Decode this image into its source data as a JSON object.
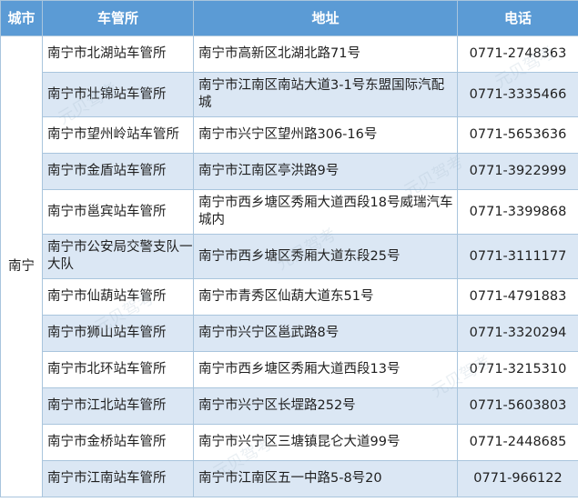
{
  "headers": [
    "城市",
    "车管所",
    "地址",
    "电话"
  ],
  "city": "南宁",
  "rows": [
    {
      "office": "南宁市北湖站车管所",
      "address": "南宁市高新区北湖北路71号",
      "phone": "0771-2748363"
    },
    {
      "office": "南宁市壮锦站车管所",
      "address": "南宁市江南区南站大道3-1号东盟国际汽配城",
      "phone": "0771-3335466"
    },
    {
      "office": "南宁市望州岭站车管所",
      "address": "南宁市兴宁区望州路306-16号",
      "phone": "0771-5653636"
    },
    {
      "office": "南宁市金盾站车管所",
      "address": "南宁市江南区亭洪路9号",
      "phone": "0771-3922999"
    },
    {
      "office": "南宁市邕宾站车管所",
      "address": "南宁市西乡塘区秀厢大道西段18号威瑞汽车城内",
      "phone": "0771-3399868"
    },
    {
      "office": "南宁市公安局交警支队一大队",
      "address": "南宁市西乡塘区秀厢大道东段25号",
      "phone": "0771-3111177"
    },
    {
      "office": "南宁市仙葫站车管所",
      "address": "南宁市青秀区仙葫大道东51号",
      "phone": "0771-4791883"
    },
    {
      "office": "南宁市狮山站车管所",
      "address": "南宁市兴宁区邕武路8号",
      "phone": "0771-3320294"
    },
    {
      "office": "南宁市北环站车管所",
      "address": "南宁市西乡塘区秀厢大道西段13号",
      "phone": "0771-3215310"
    },
    {
      "office": "南宁市江北站车管所",
      "address": "南宁市兴宁区长堽路252号",
      "phone": "0771-5603803"
    },
    {
      "office": "南宁市金桥站车管所",
      "address": "南宁市兴宁区三塘镇昆仑大道99号",
      "phone": "0771-2448685"
    },
    {
      "office": "南宁市江南站车管所",
      "address": "南宁市江南区五一中路5-8号20",
      "phone": "0771-966122"
    }
  ],
  "watermark": "元贝驾考"
}
